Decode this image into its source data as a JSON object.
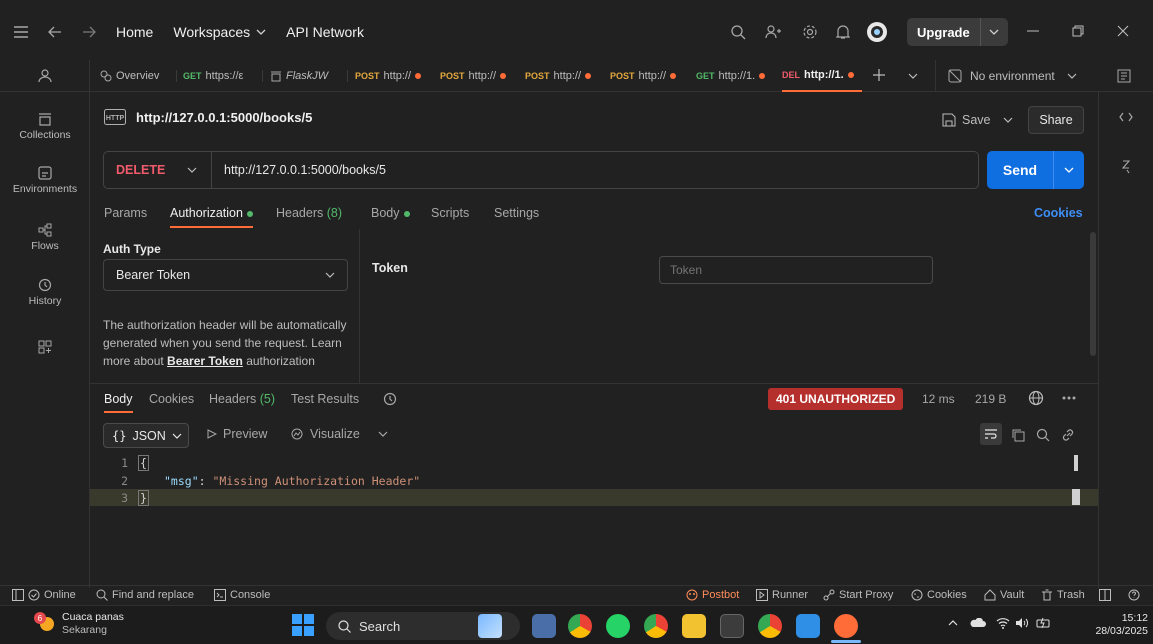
{
  "topbar": {
    "home": "Home",
    "workspaces": "Workspaces",
    "api_network": "API Network",
    "upgrade": "Upgrade"
  },
  "tabs": {
    "items": [
      {
        "method": "",
        "label": "Overviev"
      },
      {
        "method": "GET",
        "label": "https://ε"
      },
      {
        "method": "",
        "label": "FlaskJW"
      },
      {
        "method": "POST",
        "label": "http://"
      },
      {
        "method": "POST",
        "label": "http://"
      },
      {
        "method": "POST",
        "label": "http://"
      },
      {
        "method": "POST",
        "label": "http://"
      },
      {
        "method": "GET",
        "label": "http://1."
      },
      {
        "method": "DEL",
        "label": "http://1."
      }
    ],
    "environment": "No environment"
  },
  "sidebar": {
    "items": [
      {
        "label": "Collections",
        "icon": "collections-icon"
      },
      {
        "label": "Environments",
        "icon": "environments-icon"
      },
      {
        "label": "Flows",
        "icon": "flows-icon"
      },
      {
        "label": "History",
        "icon": "history-icon"
      }
    ]
  },
  "request": {
    "title": "http://127.0.0.1:5000/books/5",
    "save": "Save",
    "share": "Share",
    "method": "DELETE",
    "url": "http://127.0.0.1:5000/books/5",
    "send": "Send"
  },
  "req_tabs": {
    "params": "Params",
    "authorization": "Authorization",
    "headers": "Headers",
    "headers_count": "(8)",
    "body": "Body",
    "scripts": "Scripts",
    "settings": "Settings",
    "cookies": "Cookies"
  },
  "auth": {
    "type_label": "Auth Type",
    "type_value": "Bearer Token",
    "desc_part1": "The authorization header will be automatically generated when you send the request. Learn more about ",
    "desc_link": "Bearer Token",
    "desc_part2": " authorization",
    "token_label": "Token",
    "token_placeholder": "Token"
  },
  "response": {
    "tabs": {
      "body": "Body",
      "cookies": "Cookies",
      "headers": "Headers",
      "headers_count": "(5)",
      "test_results": "Test Results"
    },
    "status": "401 UNAUTHORIZED",
    "time": "12 ms",
    "size": "219 B",
    "format": "JSON",
    "preview": "Preview",
    "visualize": "Visualize",
    "lines": [
      "1",
      "2",
      "3"
    ],
    "code": {
      "open": "{",
      "key": "\"msg\"",
      "colon": ": ",
      "value": "\"Missing Authorization Header\"",
      "close": "}"
    }
  },
  "statusbar": {
    "online": "Online",
    "find_replace": "Find and replace",
    "console": "Console",
    "postbot": "Postbot",
    "runner": "Runner",
    "start_proxy": "Start Proxy",
    "cookies": "Cookies",
    "vault": "Vault",
    "trash": "Trash"
  },
  "taskbar": {
    "weather_title": "Cuaca panas",
    "weather_sub": "Sekarang",
    "weather_badge": "6",
    "search": "Search",
    "time": "15:12",
    "date": "28/03/2025"
  },
  "colors": {
    "accent": "#ff6c37",
    "send": "#0f6fe0",
    "error": "#b5302c",
    "success": "#53b96a"
  }
}
